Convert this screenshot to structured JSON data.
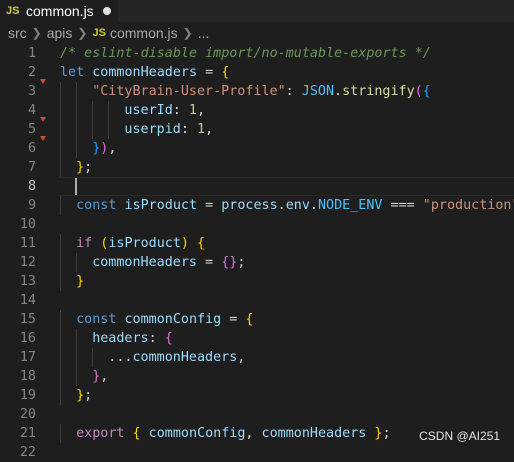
{
  "tab": {
    "icon_text": "JS",
    "filename": "common.js",
    "modified": true
  },
  "breadcrumb": {
    "parts": [
      "src",
      "apis",
      "common.js",
      "..."
    ],
    "js_icon": "JS"
  },
  "editor": {
    "active_line": 8,
    "lines": [
      {
        "n": "1",
        "tokens": [
          [
            "c-comment",
            "/* eslint-disable import/no-mutable-exports */"
          ]
        ],
        "indent": 0
      },
      {
        "n": "2",
        "tokens": [
          [
            "c-kw",
            "let "
          ],
          [
            "c-var",
            "commonHeaders"
          ],
          [
            "c-op",
            " = "
          ],
          [
            "b1",
            "{"
          ]
        ],
        "indent": 0
      },
      {
        "n": "3",
        "tokens": [
          [
            "c-str",
            "\"CityBrain-User-Profile\""
          ],
          [
            "c-op",
            ": "
          ],
          [
            "c-const",
            "JSON"
          ],
          [
            "c-op",
            "."
          ],
          [
            "c-fn",
            "stringify"
          ],
          [
            "b2",
            "("
          ],
          [
            "b3",
            "{"
          ]
        ],
        "indent": 2
      },
      {
        "n": "4",
        "tokens": [
          [
            "c-var",
            "userId"
          ],
          [
            "c-op",
            ": "
          ],
          [
            "c-num",
            "1"
          ],
          [
            "c-op",
            ","
          ]
        ],
        "indent": 4
      },
      {
        "n": "5",
        "tokens": [
          [
            "c-var",
            "userpid"
          ],
          [
            "c-op",
            ": "
          ],
          [
            "c-num",
            "1"
          ],
          [
            "c-op",
            ","
          ]
        ],
        "indent": 4
      },
      {
        "n": "6",
        "tokens": [
          [
            "b3",
            "}"
          ],
          [
            "b2",
            ")"
          ],
          [
            "c-op",
            ","
          ]
        ],
        "indent": 2
      },
      {
        "n": "7",
        "tokens": [
          [
            "b1",
            "}"
          ],
          [
            "c-op",
            ";"
          ]
        ],
        "indent": 1
      },
      {
        "n": "8",
        "tokens": [],
        "indent": 0
      },
      {
        "n": "9",
        "tokens": [
          [
            "c-kw",
            "const "
          ],
          [
            "c-var",
            "isProduct"
          ],
          [
            "c-op",
            " = "
          ],
          [
            "c-var",
            "process"
          ],
          [
            "c-op",
            "."
          ],
          [
            "c-var",
            "env"
          ],
          [
            "c-op",
            "."
          ],
          [
            "c-const",
            "NODE_ENV"
          ],
          [
            "c-op",
            " === "
          ],
          [
            "c-str",
            "\"production\""
          ],
          [
            "c-op",
            ";"
          ]
        ],
        "indent": 1
      },
      {
        "n": "10",
        "tokens": [],
        "indent": 0
      },
      {
        "n": "11",
        "tokens": [
          [
            "c-ctrl",
            "if "
          ],
          [
            "b1",
            "("
          ],
          [
            "c-var",
            "isProduct"
          ],
          [
            "b1",
            ")"
          ],
          [
            "c-op",
            " "
          ],
          [
            "b1",
            "{"
          ]
        ],
        "indent": 1
      },
      {
        "n": "12",
        "tokens": [
          [
            "c-var",
            "commonHeaders"
          ],
          [
            "c-op",
            " = "
          ],
          [
            "b2",
            "{}"
          ],
          [
            "c-op",
            ";"
          ]
        ],
        "indent": 2
      },
      {
        "n": "13",
        "tokens": [
          [
            "b1",
            "}"
          ]
        ],
        "indent": 1
      },
      {
        "n": "14",
        "tokens": [],
        "indent": 0
      },
      {
        "n": "15",
        "tokens": [
          [
            "c-kw",
            "const "
          ],
          [
            "c-var",
            "commonConfig"
          ],
          [
            "c-op",
            " = "
          ],
          [
            "b1",
            "{"
          ]
        ],
        "indent": 1
      },
      {
        "n": "16",
        "tokens": [
          [
            "c-var",
            "headers"
          ],
          [
            "c-op",
            ": "
          ],
          [
            "b2",
            "{"
          ]
        ],
        "indent": 2
      },
      {
        "n": "17",
        "tokens": [
          [
            "c-op",
            "..."
          ],
          [
            "c-var",
            "commonHeaders"
          ],
          [
            "c-op",
            ","
          ]
        ],
        "indent": 3
      },
      {
        "n": "18",
        "tokens": [
          [
            "b2",
            "}"
          ],
          [
            "c-op",
            ","
          ]
        ],
        "indent": 2
      },
      {
        "n": "19",
        "tokens": [
          [
            "b1",
            "}"
          ],
          [
            "c-op",
            ";"
          ]
        ],
        "indent": 1
      },
      {
        "n": "20",
        "tokens": [],
        "indent": 0
      },
      {
        "n": "21",
        "tokens": [
          [
            "c-ctrl",
            "export "
          ],
          [
            "b1",
            "{"
          ],
          [
            "c-op",
            " "
          ],
          [
            "c-var",
            "commonConfig"
          ],
          [
            "c-op",
            ", "
          ],
          [
            "c-var",
            "commonHeaders"
          ],
          [
            "c-op",
            " "
          ],
          [
            "b1",
            "}"
          ],
          [
            "c-op",
            ";"
          ]
        ],
        "indent": 1
      },
      {
        "n": "22",
        "tokens": [],
        "indent": 0
      }
    ],
    "change_markers": [
      3,
      5,
      6
    ]
  },
  "watermark": "CSDN @AI251"
}
